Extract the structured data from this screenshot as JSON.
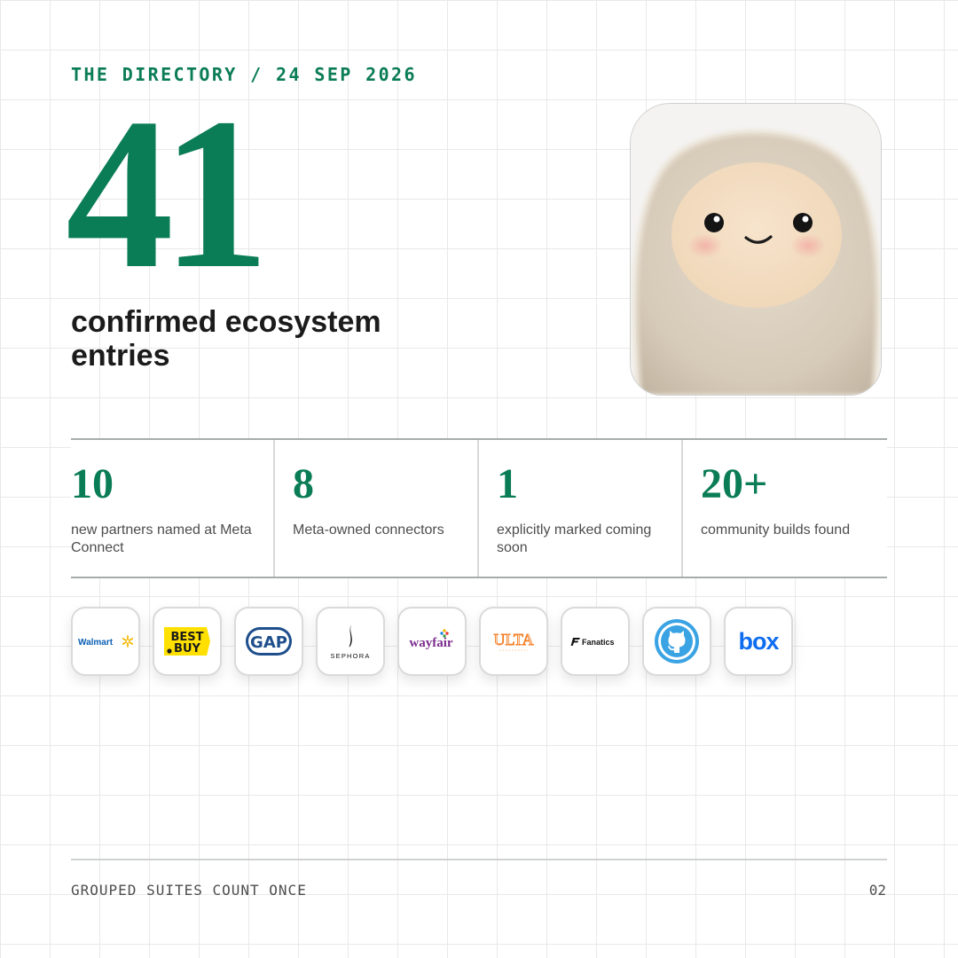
{
  "header": {
    "eyebrow": "THE DIRECTORY / 24 SEP 2026"
  },
  "hero": {
    "number": "41",
    "caption": "confirmed ecosystem entries"
  },
  "mascot": {
    "icon": "fluffy-mascot-avatar"
  },
  "stats": [
    {
      "value": "10",
      "label": "new partners named at Meta Connect"
    },
    {
      "value": "8",
      "label": "Meta-owned connectors"
    },
    {
      "value": "1",
      "label": "explicitly marked coming soon"
    },
    {
      "value": "20+",
      "label": "community builds found"
    }
  ],
  "logos": [
    {
      "name": "walmart-logo",
      "text": "Walmart"
    },
    {
      "name": "bestbuy-logo",
      "text_top": "BEST",
      "text_bottom": "BUY"
    },
    {
      "name": "gap-logo",
      "text": "GAP"
    },
    {
      "name": "sephora-logo",
      "text": "SEPHORA"
    },
    {
      "name": "wayfair-logo",
      "text": "wayfair"
    },
    {
      "name": "ulta-logo",
      "text": "ULTA"
    },
    {
      "name": "fanatics-logo",
      "text": "Fanatics"
    },
    {
      "name": "github-logo"
    },
    {
      "name": "box-logo",
      "text": "box"
    }
  ],
  "footer": {
    "note": "GROUPED SUITES COUNT ONCE",
    "page": "02"
  },
  "colors": {
    "accent": "#0a7c56",
    "text": "#1b1b1b",
    "muted": "#4d4d4d"
  }
}
